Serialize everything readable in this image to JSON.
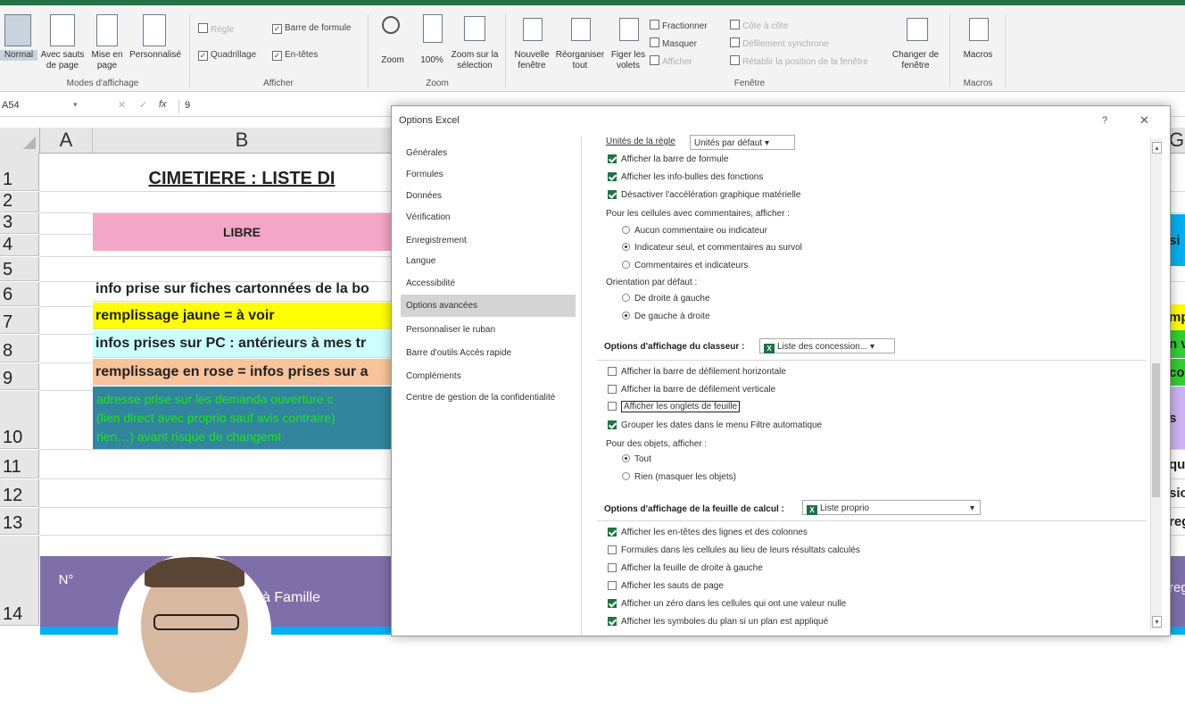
{
  "ribbon": {
    "views": {
      "normal": "Normal",
      "page_break": "Avec sauts de page",
      "page_layout": "Mise en page",
      "custom": "Personnalisé",
      "group": "Modes d'affichage"
    },
    "show": {
      "ruler": "Règle",
      "gridlines": "Quadrillage",
      "formula_bar": "Barre de formule",
      "headings": "En-têtes",
      "group": "Afficher"
    },
    "zoom": {
      "zoom": "Zoom",
      "hundred": "100%",
      "selection": "Zoom sur la sélection",
      "group": "Zoom"
    },
    "window": {
      "new": "Nouvelle fenêtre",
      "arrange": "Réorganiser tout",
      "freeze": "Figer les volets",
      "split": "Fractionner",
      "hide": "Masquer",
      "unhide": "Afficher",
      "side": "Côte à côte",
      "sync": "Défilement synchrone",
      "reset": "Rétablir la position de la fenêtre",
      "switch": "Changer de fenêtre",
      "group": "Fenêtre"
    },
    "macros": {
      "label": "Macros",
      "group": "Macros"
    }
  },
  "formula_bar": {
    "name_box": "A54",
    "fx": "fx",
    "value": "9"
  },
  "sheet": {
    "columns": [
      "A",
      "B",
      "G"
    ],
    "rows": [
      "1",
      "2",
      "3",
      "4",
      "5",
      "6",
      "7",
      "8",
      "9",
      "10",
      "11",
      "12",
      "13",
      "14"
    ],
    "title": "CIMETIERE : LISTE DI",
    "libre": "LIBRE",
    "r5": "info prise sur fiches cartonnées de la bo",
    "r6": "remplissage jaune = à voir",
    "r7": "infos prises sur PC : antérieurs à mes tr",
    "r8": "remplissage en rose = infos prises sur a",
    "r9": [
      "adresse prise sur les demanda ouverture c",
      "(lien direct avec proprio sauf avis contraire)",
      "rien…) avant risque de changemt"
    ],
    "header_n": "N°",
    "header_famille": "à Famille",
    "right_frags": [
      "si",
      "mp",
      "n v",
      "co",
      "s",
      "que",
      "sio",
      "reg"
    ],
    "colors": {
      "libre": "#f4a6c6",
      "yellow": "#ffff00",
      "cyan": "#ccffff",
      "peach": "#f8c29a",
      "teal": "#31859c",
      "header": "#7f6fa8"
    }
  },
  "dialog": {
    "title": "Options Excel",
    "help": "?",
    "close": "✕",
    "nav": [
      "Générales",
      "Formules",
      "Données",
      "Vérification",
      "Enregistrement",
      "Langue",
      "Accessibilité",
      "Options avancées",
      "Personnaliser le ruban",
      "Barre d'outils Accès rapide",
      "Compléments",
      "Centre de gestion de la confidentialité"
    ],
    "selected": 7,
    "ruler_units_label": "Unités de la règle",
    "ruler_units_value": "Unités par défaut",
    "opt1": "Afficher la barre de formule",
    "opt2": "Afficher les info-bulles des fonctions",
    "opt3": "Désactiver l'accélération graphique matérielle",
    "comments_label": "Pour les cellules avec commentaires, afficher :",
    "comments_opts": [
      "Aucun commentaire ou indicateur",
      "Indicateur seul, et commentaires au survol",
      "Commentaires et indicateurs"
    ],
    "orient_label": "Orientation par défaut :",
    "orient_opts": [
      "De droite à gauche",
      "De gauche à droite"
    ],
    "wb_section": "Options d'affichage du classeur :",
    "wb_combo": "Liste des concession...",
    "wb_opts": [
      "Afficher la barre de défilement horizontale",
      "Afficher la barre de défilement verticale",
      "Afficher les onglets de feuille",
      "Grouper les dates dans le menu Filtre automatique"
    ],
    "objects_label": "Pour des objets, afficher :",
    "objects_opts": [
      "Tout",
      "Rien (masquer les objets)"
    ],
    "ws_section": "Options d'affichage de la feuille de calcul :",
    "ws_combo": "Liste proprio",
    "ws_opts": [
      "Afficher les en-têtes des lignes et des colonnes",
      "Formules dans les cellules au lieu de leurs résultats calculés",
      "Afficher la feuille de droite à gauche",
      "Afficher les sauts de page",
      "Afficher un zéro dans les cellules qui ont une valeur nulle",
      "Afficher les symboles du plan si un plan est appliqué"
    ]
  }
}
